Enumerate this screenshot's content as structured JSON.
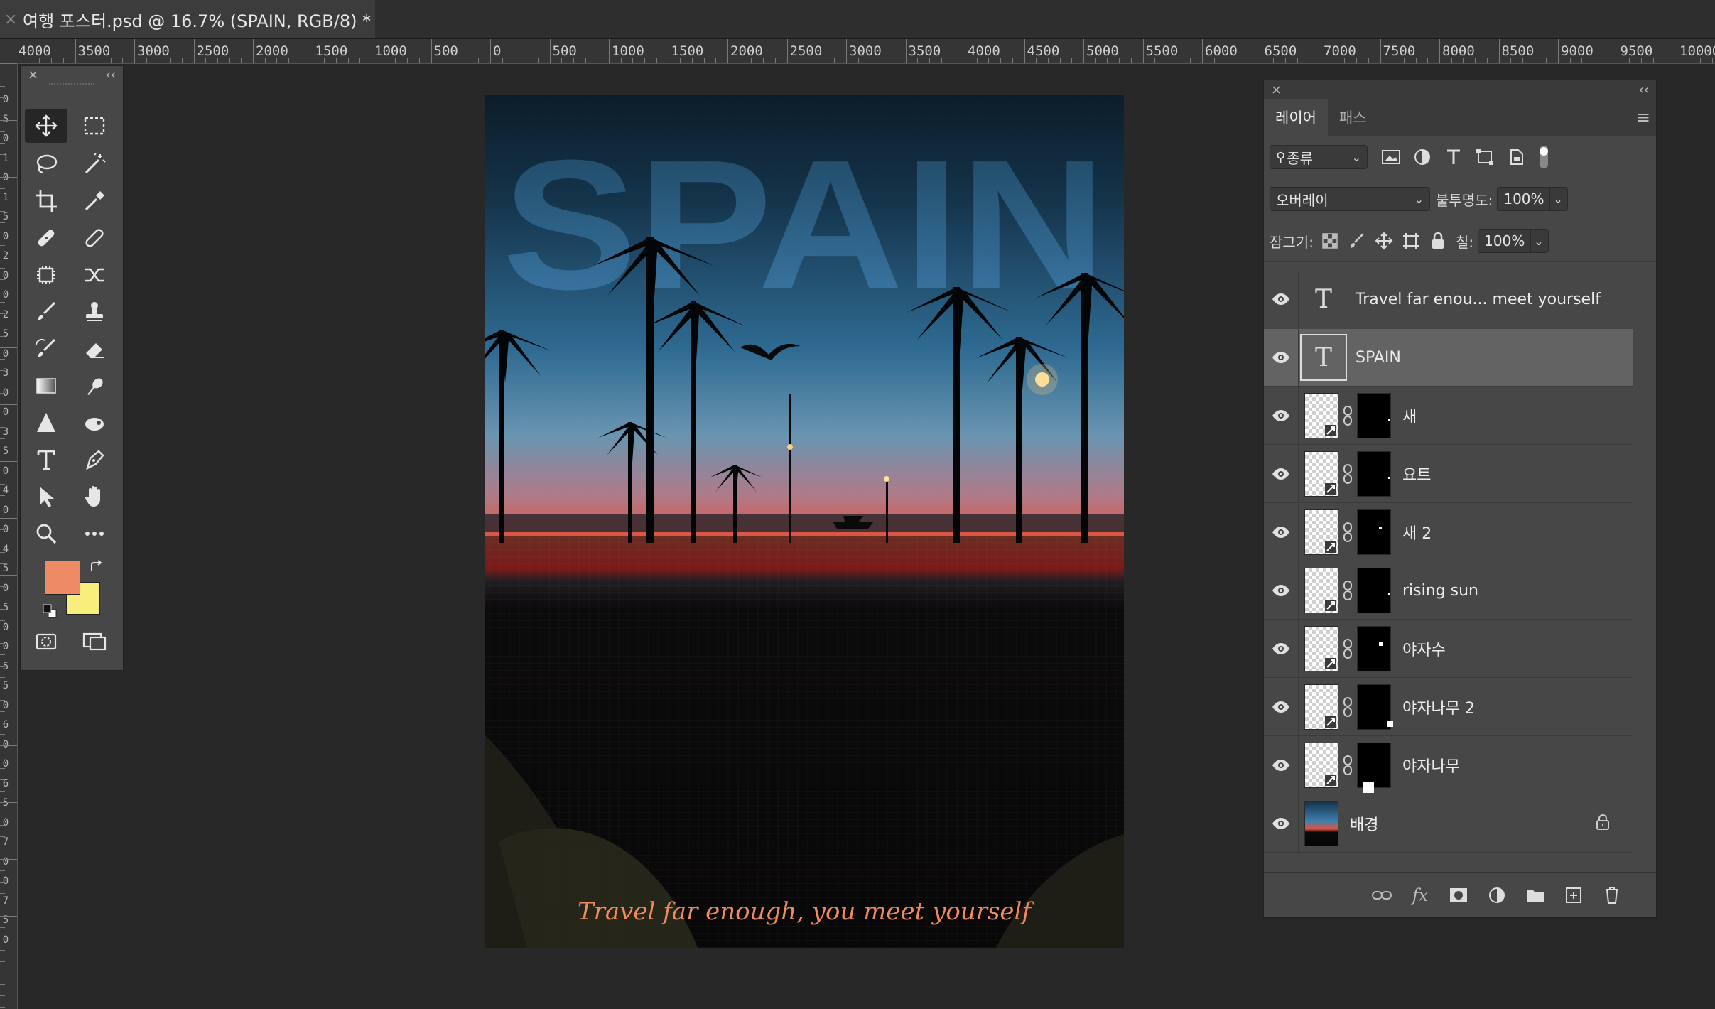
{
  "tab": {
    "title": "여행 포스터.psd @ 16.7% (SPAIN, RGB/8) *",
    "close": "×"
  },
  "ruler": {
    "h_labels": [
      "4000",
      "3500",
      "3000",
      "2500",
      "2000",
      "1500",
      "1000",
      "500",
      "0",
      "500",
      "1000",
      "1500",
      "2000",
      "2500",
      "3000",
      "3500",
      "4000",
      "4500",
      "5000",
      "5500",
      "6000",
      "6500",
      "7000",
      "7500",
      "8000",
      "8500",
      "9000",
      "9500",
      "10000"
    ],
    "v_labels": [
      "0",
      "5",
      "0",
      "1",
      "0",
      "1",
      "5",
      "0",
      "2",
      "0",
      "0",
      "2",
      "5",
      "0",
      "3",
      "0",
      "0",
      "3",
      "5",
      "0",
      "4",
      "0",
      "0",
      "4",
      "5",
      "0",
      "5",
      "0",
      "0",
      "5",
      "5",
      "0",
      "6",
      "0",
      "0",
      "6",
      "5",
      "0",
      "7",
      "0",
      "0",
      "7",
      "5",
      "0"
    ]
  },
  "tools": {
    "close": "×",
    "collapse": "‹‹",
    "foreground_color": "#ef8a66",
    "background_color": "#f7ee7c"
  },
  "poster": {
    "headline": "SPAIN",
    "tagline": "Travel far enough, you meet yourself"
  },
  "layers_panel": {
    "close": "×",
    "collapse": "‹‹",
    "tabs": [
      "레이어",
      "패스"
    ],
    "filter_label": "종류",
    "blend_mode": "오버레이",
    "opacity_label": "불투명도:",
    "opacity_value": "100%",
    "lock_label": "잠그기:",
    "fill_label": "칠:",
    "fill_value": "100%",
    "layers": [
      {
        "name": "Travel far enou... meet yourself",
        "kind": "text"
      },
      {
        "name": "SPAIN",
        "kind": "text",
        "selected": true
      },
      {
        "name": "새",
        "kind": "masked"
      },
      {
        "name": "요트",
        "kind": "masked"
      },
      {
        "name": "새 2",
        "kind": "masked"
      },
      {
        "name": "rising sun",
        "kind": "masked"
      },
      {
        "name": "야자수",
        "kind": "masked"
      },
      {
        "name": "야자나무 2",
        "kind": "masked"
      },
      {
        "name": "야자나무",
        "kind": "masked"
      },
      {
        "name": "배경",
        "kind": "background",
        "locked": true
      }
    ]
  }
}
